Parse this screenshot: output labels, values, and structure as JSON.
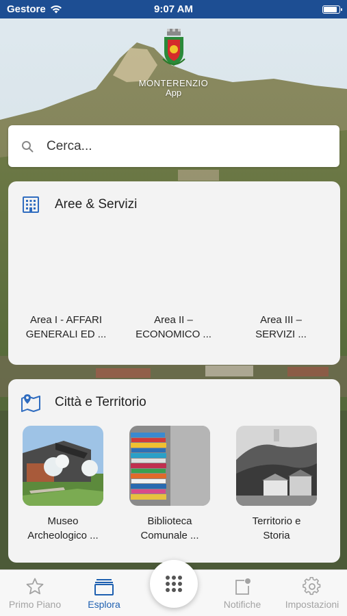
{
  "status_bar": {
    "carrier": "Gestore",
    "time": "9:07 AM"
  },
  "logo": {
    "name": "MONTERENZIO",
    "subtitle": "App"
  },
  "search": {
    "placeholder": "Cerca..."
  },
  "areas": {
    "title": "Aree & Servizi",
    "items": [
      {
        "line1": "Area I - AFFARI",
        "line2": "GENERALI ED ..."
      },
      {
        "line1": "Area II –",
        "line2": "ECONOMICO ..."
      },
      {
        "line1": "Area III –",
        "line2": "SERVIZI ..."
      }
    ]
  },
  "territory": {
    "title": "Città e Territorio",
    "items": [
      {
        "line1": "Museo",
        "line2": "Archeologico ...",
        "icon": "museum-photo"
      },
      {
        "line1": "Biblioteca",
        "line2": "Comunale ...",
        "icon": "books-photo"
      },
      {
        "line1": "Territorio e",
        "line2": "Storia",
        "icon": "historic-photo"
      }
    ]
  },
  "tabbar": {
    "items": [
      {
        "label": "Primo Piano",
        "icon": "star-icon",
        "active": false
      },
      {
        "label": "Esplora",
        "icon": "cards-icon",
        "active": true
      },
      {
        "label": "Notifiche",
        "icon": "notification-icon",
        "active": false
      },
      {
        "label": "Impostazioni",
        "icon": "gear-icon",
        "active": false
      }
    ],
    "center_button": {
      "icon": "grid-dots-icon"
    }
  },
  "colors": {
    "primary": "#1d4e93",
    "active_tab": "#1d5fb0",
    "inactive_tab": "#a3a3a3",
    "card_bg": "#f3f3f3"
  }
}
